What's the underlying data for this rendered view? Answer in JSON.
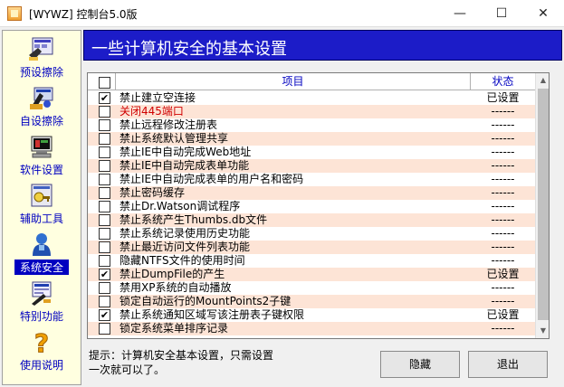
{
  "window": {
    "title": "[WYWZ] 控制台5.0版",
    "minimize": "—",
    "maximize": "☐",
    "close": "✕"
  },
  "sidebar": {
    "items": [
      {
        "label": "预设擦除",
        "icon": "preset-erase-icon"
      },
      {
        "label": "自设擦除",
        "icon": "custom-erase-icon"
      },
      {
        "label": "软件设置",
        "icon": "software-settings-icon"
      },
      {
        "label": "辅助工具",
        "icon": "tools-icon"
      },
      {
        "label": "系统安全",
        "icon": "system-security-icon",
        "active": true
      },
      {
        "label": "特别功能",
        "icon": "special-functions-icon"
      },
      {
        "label": "使用说明",
        "icon": "help-icon"
      }
    ]
  },
  "banner": {
    "title": "一些计算机安全的基本设置"
  },
  "table": {
    "header": {
      "item": "项目",
      "status": "状态"
    },
    "rows": [
      {
        "checked": true,
        "label": "禁止建立空连接",
        "status": "已设置",
        "red": false
      },
      {
        "checked": false,
        "label": "关闭445端口",
        "status": "------",
        "red": true
      },
      {
        "checked": false,
        "label": "禁止远程修改注册表",
        "status": "------",
        "red": false
      },
      {
        "checked": false,
        "label": "禁止系统默认管理共享",
        "status": "------",
        "red": false
      },
      {
        "checked": false,
        "label": "禁止IE中自动完成Web地址",
        "status": "------",
        "red": false
      },
      {
        "checked": false,
        "label": "禁止IE中自动完成表单功能",
        "status": "------",
        "red": false
      },
      {
        "checked": false,
        "label": "禁止IE中自动完成表单的用户名和密码",
        "status": "------",
        "red": false
      },
      {
        "checked": false,
        "label": "禁止密码缓存",
        "status": "------",
        "red": false
      },
      {
        "checked": false,
        "label": "禁止Dr.Watson调试程序",
        "status": "------",
        "red": false
      },
      {
        "checked": false,
        "label": "禁止系统产生Thumbs.db文件",
        "status": "------",
        "red": false
      },
      {
        "checked": false,
        "label": "禁止系统记录使用历史功能",
        "status": "------",
        "red": false
      },
      {
        "checked": false,
        "label": "禁止最近访问文件列表功能",
        "status": "------",
        "red": false
      },
      {
        "checked": false,
        "label": "隐藏NTFS文件的使用时间",
        "status": "------",
        "red": false
      },
      {
        "checked": true,
        "label": "禁止DumpFile的产生",
        "status": "已设置",
        "red": false
      },
      {
        "checked": false,
        "label": "禁用XP系统的自动播放",
        "status": "------",
        "red": false
      },
      {
        "checked": false,
        "label": "锁定自动运行的MountPoints2子键",
        "status": "------",
        "red": false
      },
      {
        "checked": true,
        "label": "禁止系统通知区域写该注册表子键权限",
        "status": "已设置",
        "red": false
      },
      {
        "checked": false,
        "label": "锁定系统菜单排序记录",
        "status": "------",
        "red": false
      }
    ]
  },
  "footer": {
    "hint_line1": "提示：计算机安全基本设置，只需设置",
    "hint_line2": "一次就可以了。",
    "hide_button": "隐藏",
    "exit_button": "退出"
  },
  "colors": {
    "banner": "#1c1cc8",
    "sidebar_bg": "#ffffe0",
    "nav_text": "#0000c0",
    "row_alt": "#fde4d6",
    "red_text": "#d00000"
  }
}
